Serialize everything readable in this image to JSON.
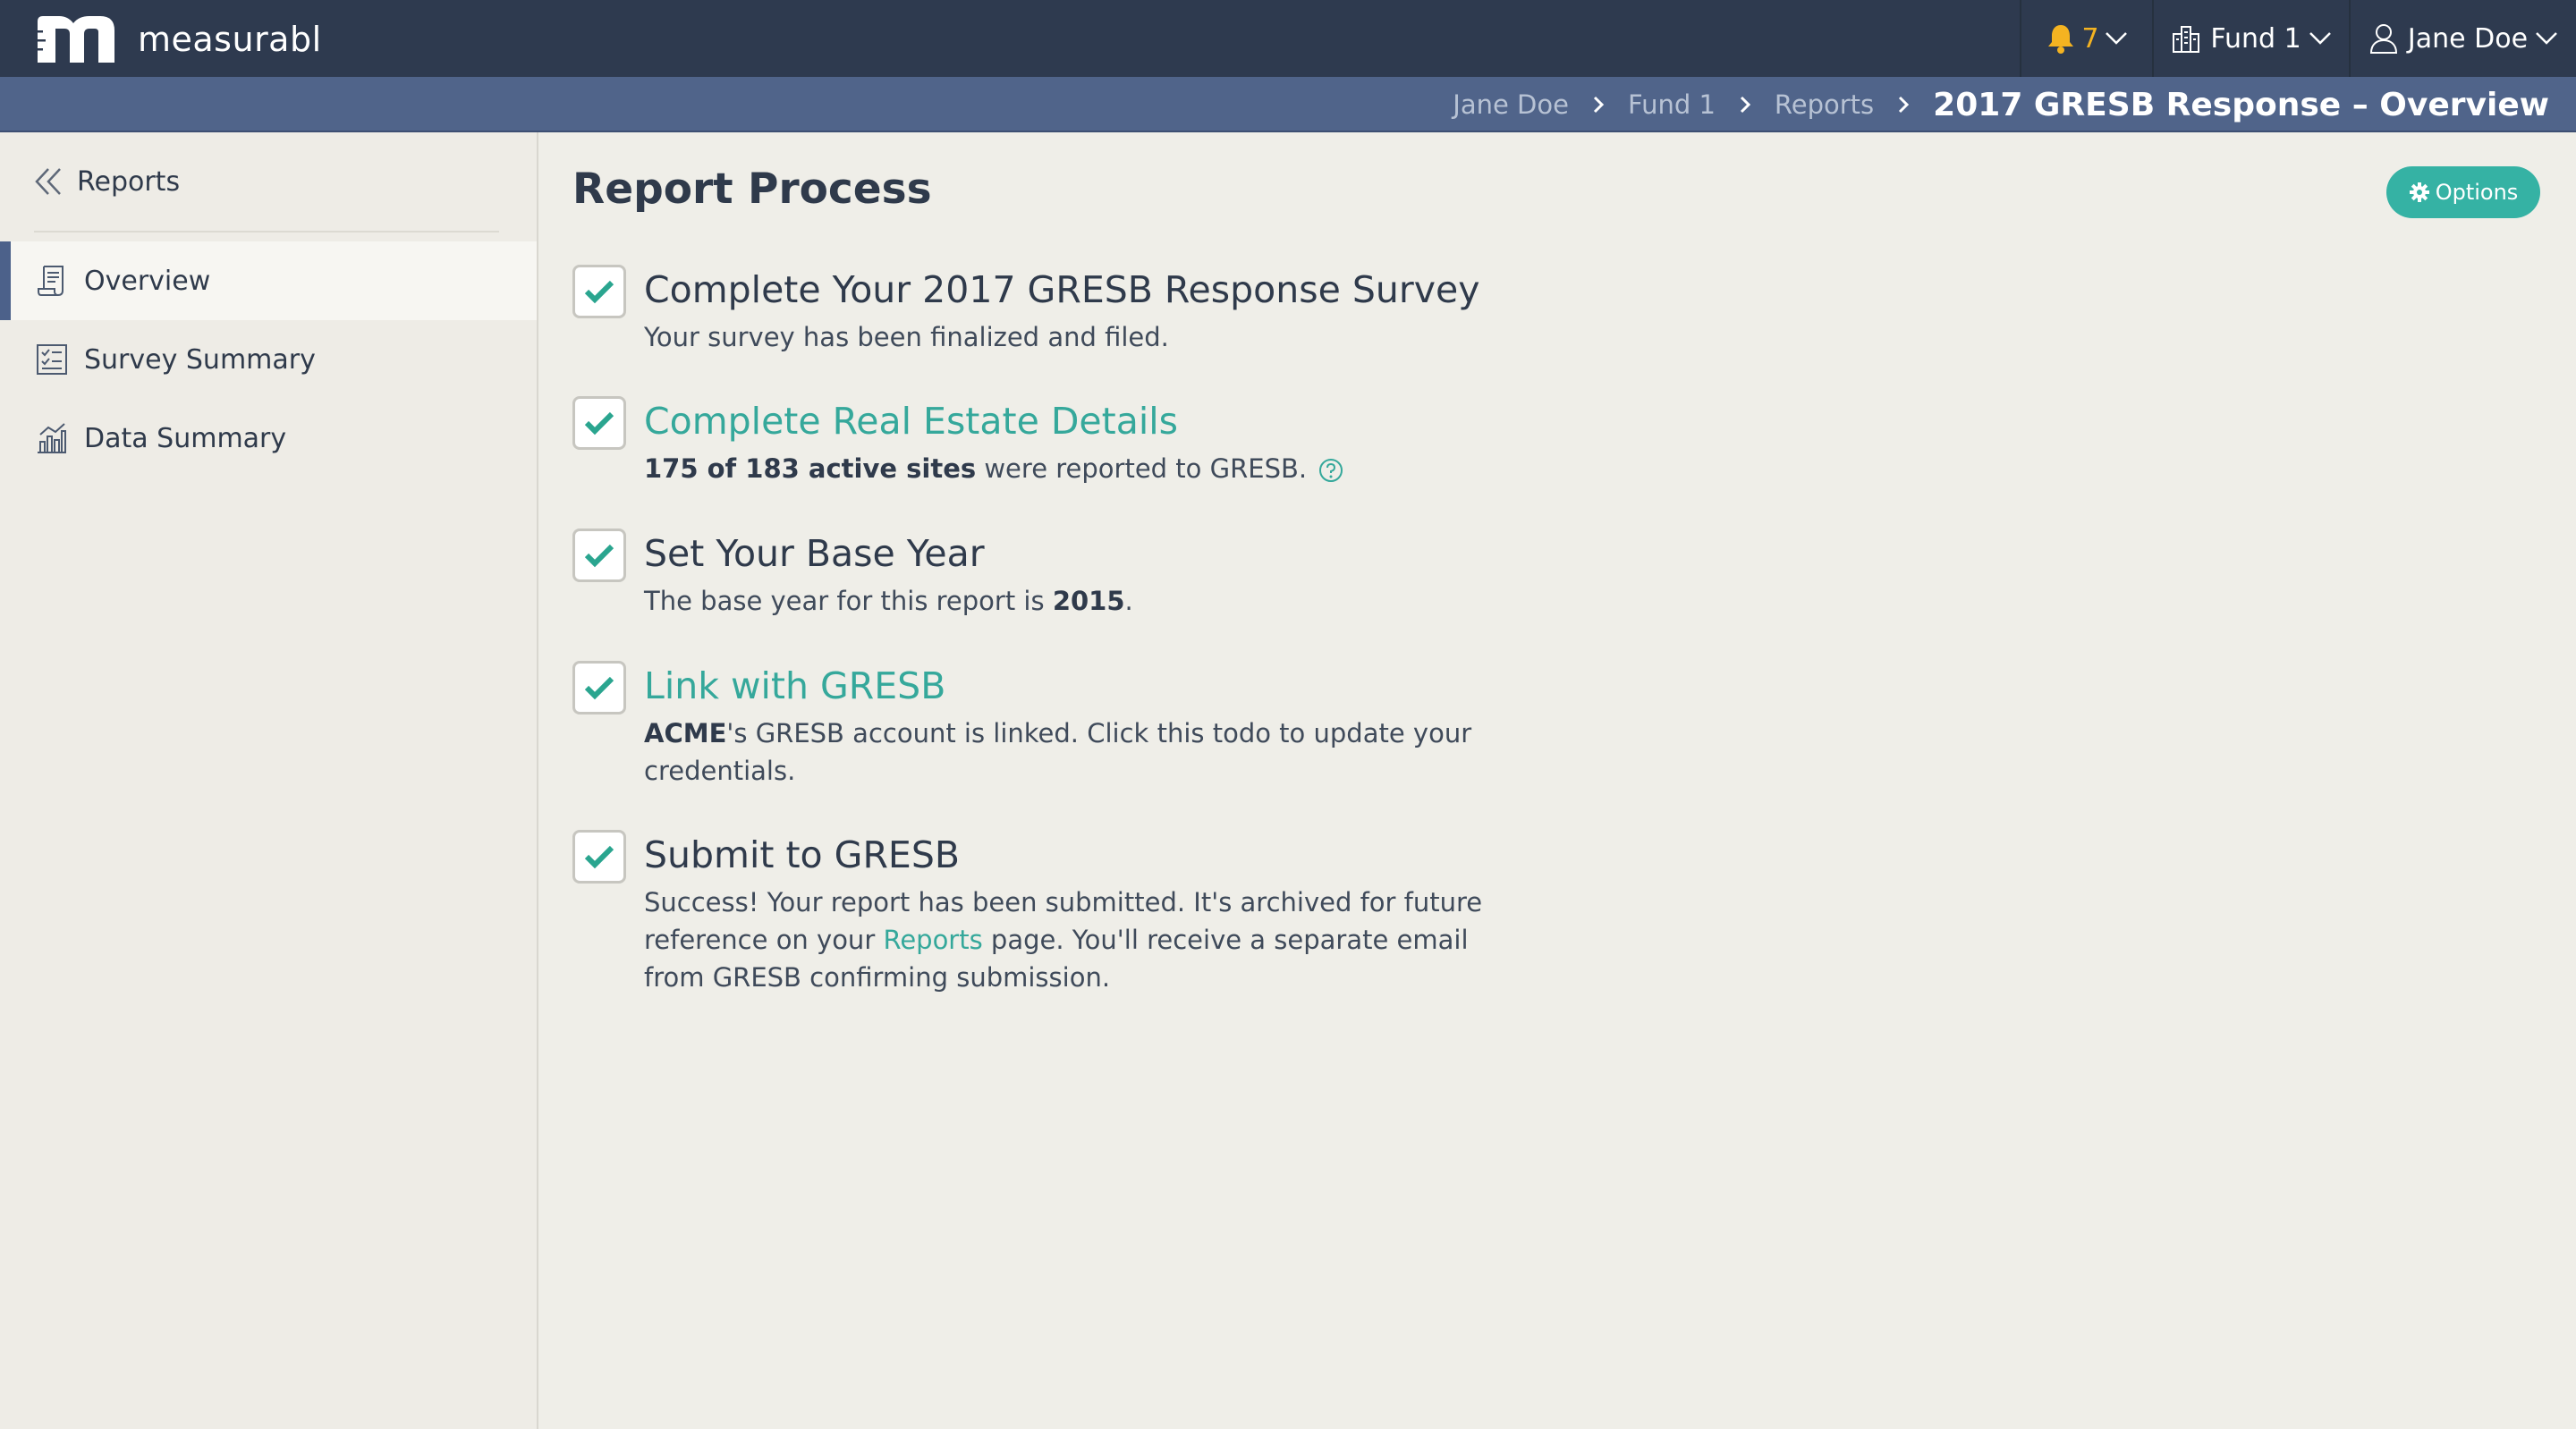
{
  "brand": {
    "name": "measurabl"
  },
  "topnav": {
    "notifications": {
      "icon": "bell-icon",
      "count": "7",
      "accent": "#f4b321"
    },
    "fund": {
      "icon": "buildings-icon",
      "label": "Fund 1"
    },
    "user": {
      "icon": "user-icon",
      "label": "Jane Doe"
    }
  },
  "breadcrumb": {
    "items": [
      "Jane Doe",
      "Fund 1",
      "Reports"
    ],
    "current": "2017 GRESB Response – Overview"
  },
  "sidebar": {
    "back": {
      "icon": "double-chevron-left-icon",
      "label": "Reports"
    },
    "items": [
      {
        "label": "Overview",
        "icon": "report-doc-icon",
        "active": true
      },
      {
        "label": "Survey Summary",
        "icon": "checklist-icon",
        "active": false
      },
      {
        "label": "Data Summary",
        "icon": "bar-chart-icon",
        "active": false
      }
    ]
  },
  "main": {
    "title": "Report Process",
    "options_label": "Options",
    "tasks": [
      {
        "title": "Complete Your 2017 GRESB Response Survey",
        "checked": true,
        "desc": "Your survey has been finalized and filed."
      },
      {
        "title": "Complete Real Estate Details",
        "checked": true,
        "desc_bold": "175 of 183 active sites",
        "desc_rest": " were reported to GRESB."
      },
      {
        "title": "Set Your Base Year",
        "checked": true,
        "desc_pre": "The base year for this report is ",
        "desc_bold": "2015",
        "desc_post": "."
      },
      {
        "title": "Link with GRESB",
        "checked": true,
        "desc_bold": "ACME",
        "desc_rest": "'s GRESB account is linked. Click this todo to update your credentials."
      },
      {
        "title": "Submit to GRESB",
        "checked": true,
        "desc_pre": "Success! Your report has been submitted. It's archived for future reference on your ",
        "desc_link": "Reports",
        "desc_post": " page. You'll receive a separate email from GRESB confirming submission."
      }
    ]
  },
  "colors": {
    "topbar": "#2e3a4f",
    "breadcrumb_bar": "#50648a",
    "teal_accent": "#35b2a4",
    "check_green": "#2aa58f"
  }
}
